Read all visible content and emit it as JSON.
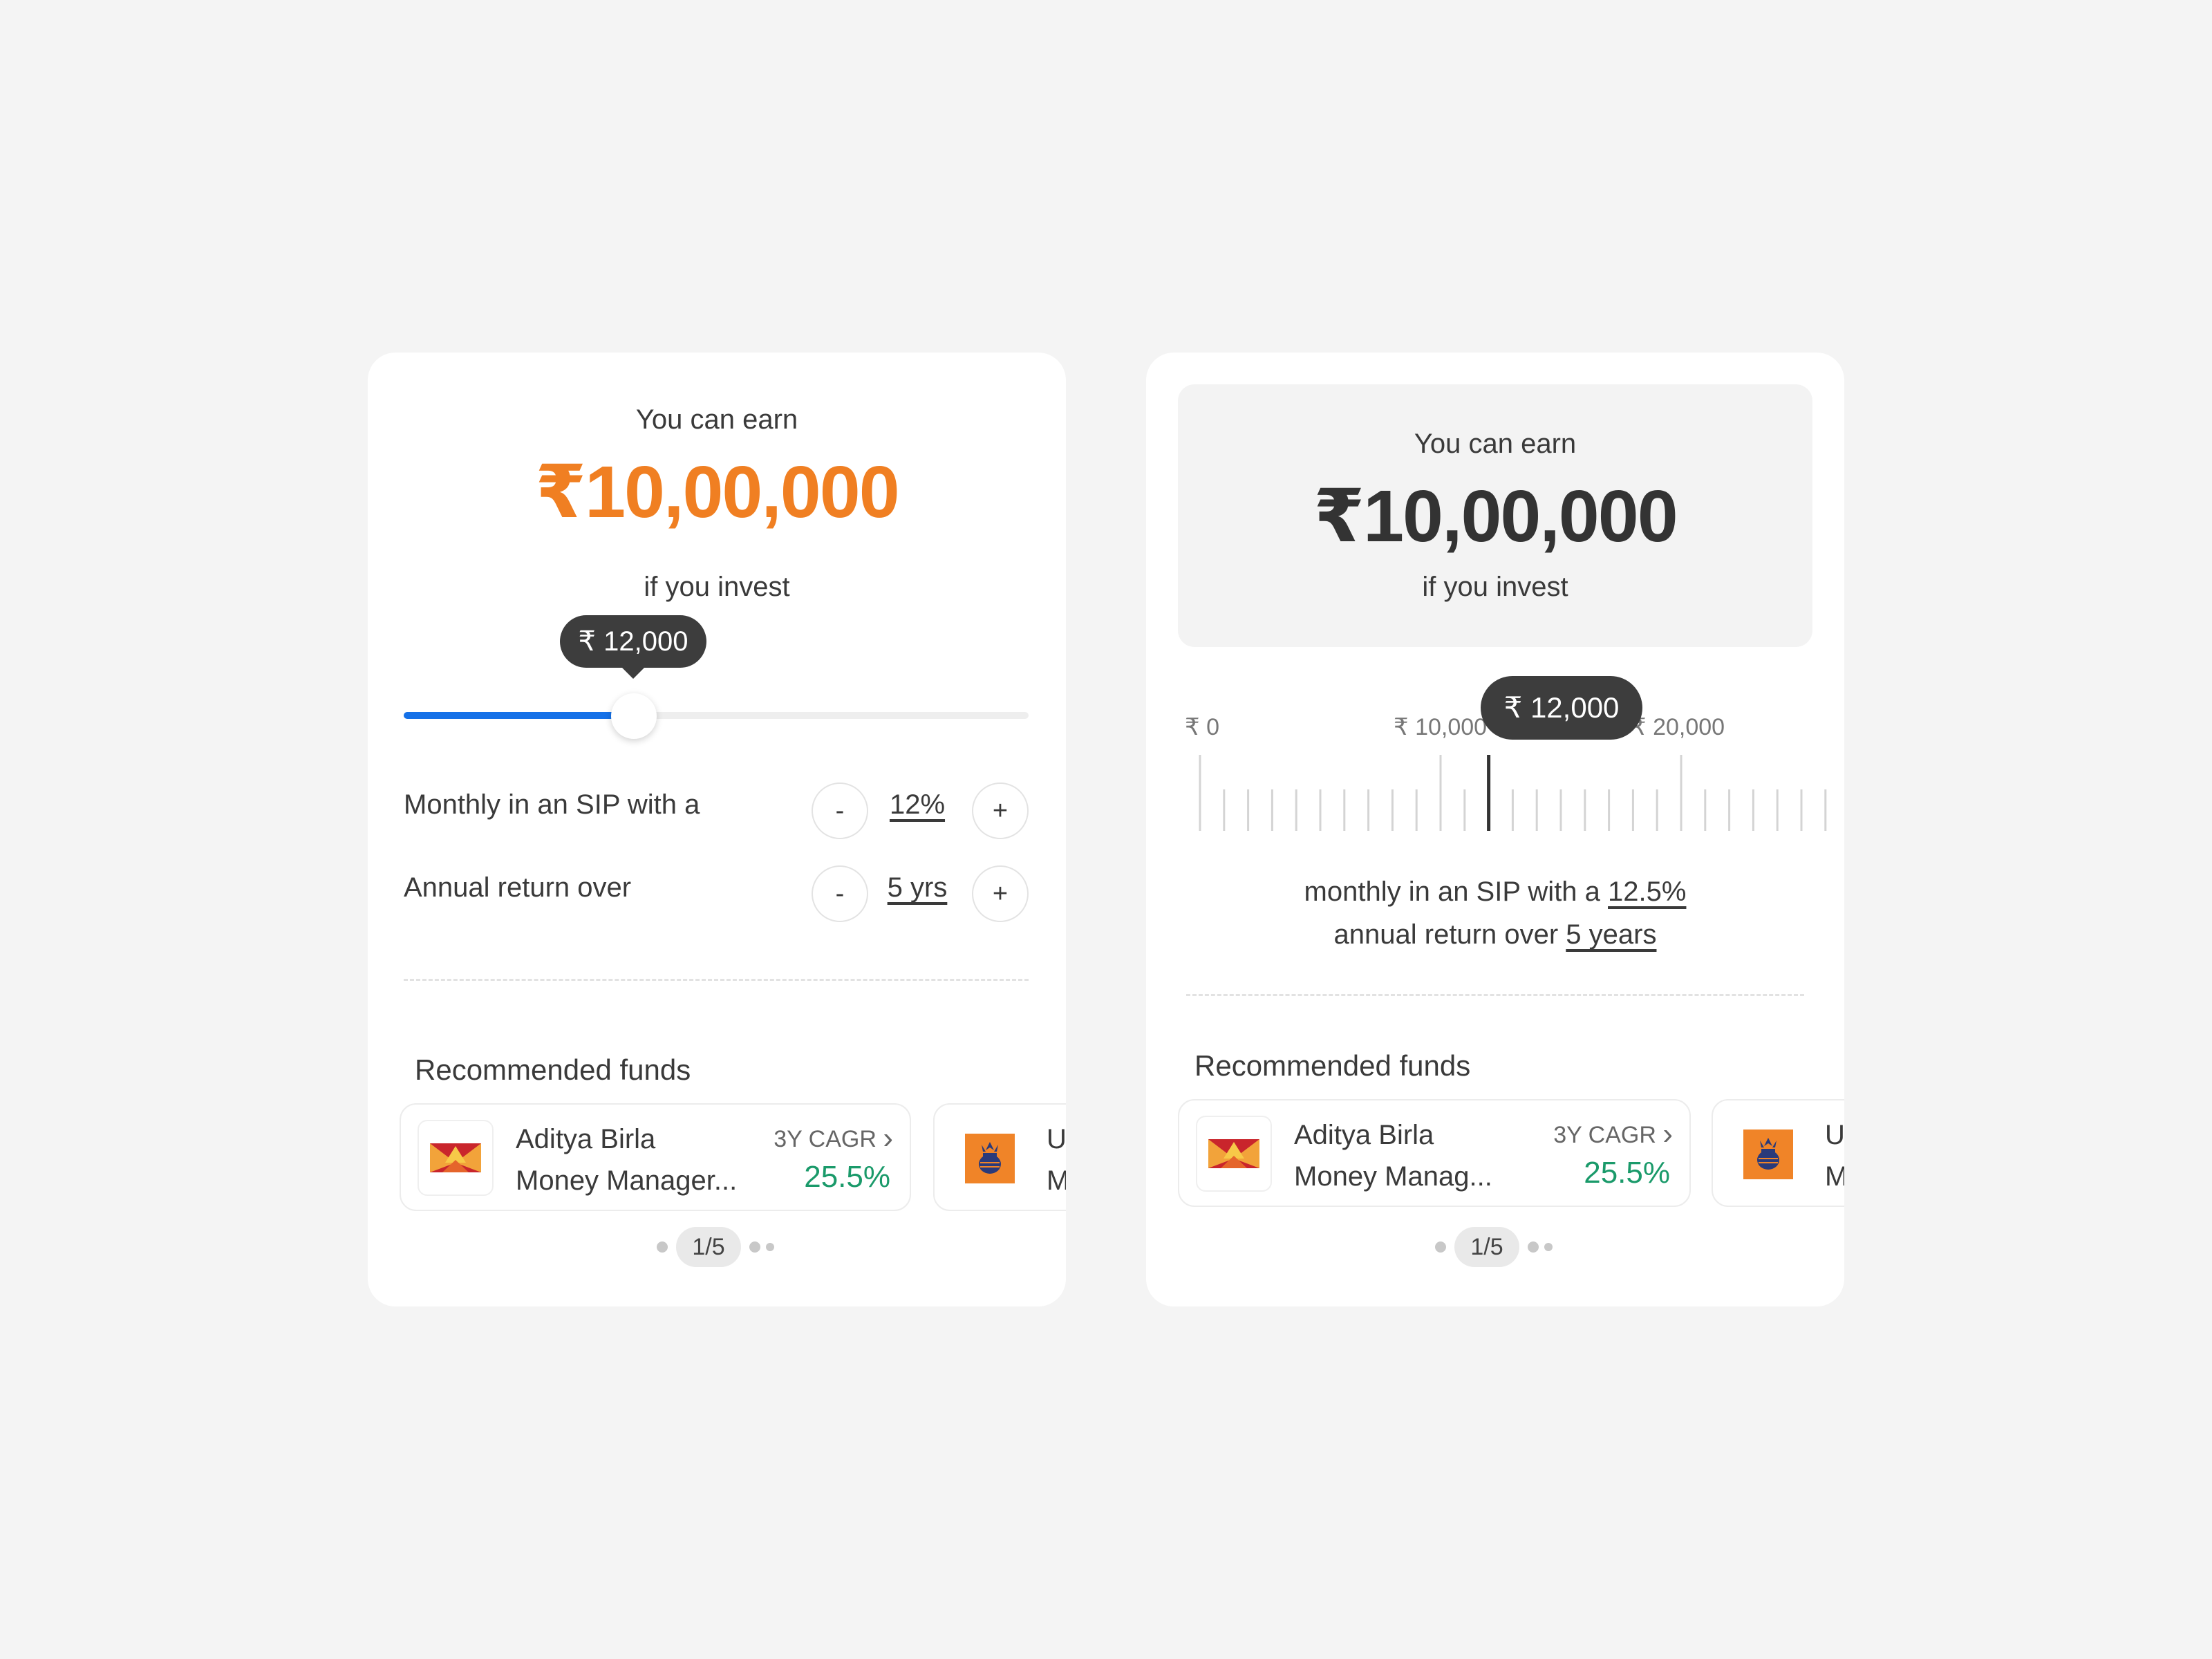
{
  "card_left": {
    "earn_label": "You can earn",
    "earn_amount": "₹10,00,000",
    "invest_label": "if you invest",
    "slider": {
      "value_label": "₹ 12,000",
      "fill_fraction": 0.36
    },
    "sip_row": {
      "label": "Monthly in an SIP with a",
      "minus": "-",
      "value": "12%",
      "plus": "+"
    },
    "return_row": {
      "label": "Annual return over",
      "minus": "-",
      "value": "5 yrs",
      "plus": "+"
    },
    "recommended_title": "Recommended funds",
    "fund": {
      "name_line1": "Aditya Birla",
      "name_line2": "Money Manager...",
      "cagr_label": "3Y CAGR",
      "cagr_chevron": "›",
      "cagr_value": "25.5%"
    },
    "peek_fund": {
      "line1": "U",
      "line2": "M"
    },
    "pager": "1/5"
  },
  "card_right": {
    "earn_label": "You can earn",
    "earn_amount": "₹10,00,000",
    "invest_label": "if you invest",
    "ruler": {
      "labels": [
        "₹ 0",
        "₹ 10,000",
        "₹ 20,000"
      ],
      "selected_label": "₹ 12,000",
      "selected_value": 12000,
      "max_visible": 26000,
      "step": 1000
    },
    "sentence_line1_prefix": "monthly in an SIP with a",
    "sentence_line1_value": "12.5%",
    "sentence_line2_prefix": "annual return over",
    "sentence_line2_value": "5 years",
    "recommended_title": "Recommended funds",
    "fund": {
      "name_line1": "Aditya Birla",
      "name_line2": "Money Manag...",
      "cagr_label": "3Y CAGR",
      "cagr_chevron": "›",
      "cagr_value": "25.5%"
    },
    "peek_fund": {
      "line1": "U",
      "line2": "M"
    },
    "pager": "1/5"
  },
  "colors": {
    "accent_orange": "#f07f22",
    "slider_blue": "#1571e8",
    "positive_green": "#1a9a6a",
    "tooltip_dark": "#3d3d3d"
  },
  "icons": [
    "aditya-birla-logo-icon",
    "uti-kalash-logo-icon",
    "chevron-right-icon"
  ]
}
